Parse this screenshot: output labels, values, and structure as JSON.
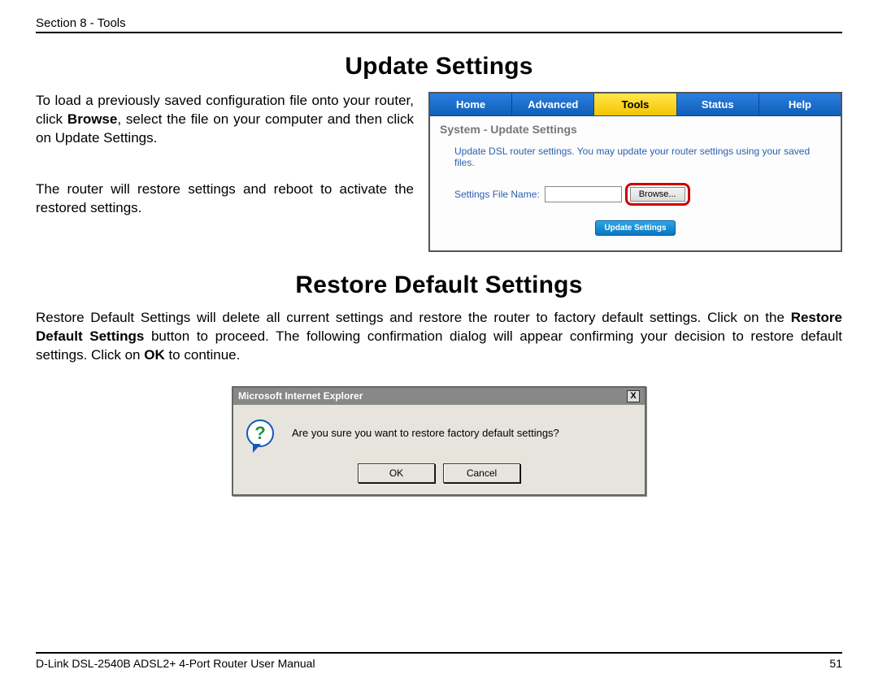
{
  "header": {
    "section": "Section 8 - Tools"
  },
  "update": {
    "title": "Update Settings",
    "p1_a": "To load a previously saved configuration file onto your router, click ",
    "p1_bold": "Browse",
    "p1_b": ", select the file on your computer and then click on Update Settings.",
    "p2": "The router will restore settings and reboot to activate the restored settings."
  },
  "router": {
    "tabs": {
      "home": "Home",
      "advanced": "Advanced",
      "tools": "Tools",
      "status": "Status",
      "help": "Help"
    },
    "heading": "System - Update Settings",
    "desc": "Update DSL router settings. You may update your router settings using your saved files.",
    "file_label": "Settings File Name:",
    "browse": "Browse...",
    "update_btn": "Update Settings"
  },
  "restore": {
    "title": "Restore Default Settings",
    "p_a": "Restore Default Settings will delete all current settings and restore the router to factory default settings. Click on the ",
    "p_bold1": "Restore Default Settings",
    "p_b": " button to proceed. The following confirmation dialog will appear confirming your decision to restore default settings. Click on ",
    "p_bold2": "OK",
    "p_c": " to continue."
  },
  "dialog": {
    "title": "Microsoft Internet Explorer",
    "close": "X",
    "question_mark": "?",
    "text": "Are you sure you want to restore factory default settings?",
    "ok": "OK",
    "cancel": "Cancel"
  },
  "footer": {
    "left": "D-Link DSL-2540B ADSL2+ 4-Port Router User Manual",
    "right": "51"
  }
}
